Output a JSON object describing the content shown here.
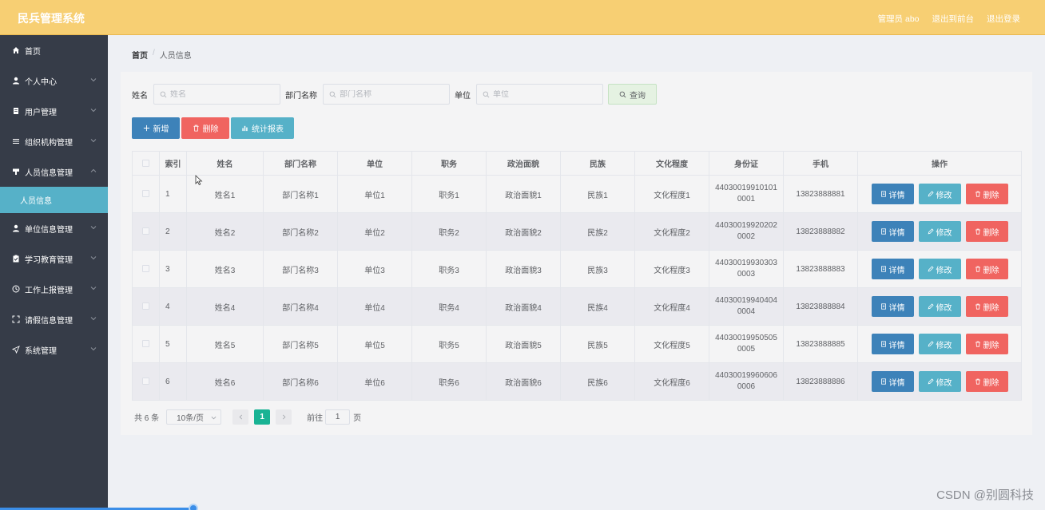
{
  "header": {
    "title": "民兵管理系统",
    "role": "管理员 abo",
    "back_link": "退出到前台",
    "logout_link": "退出登录"
  },
  "sidebar": {
    "items": [
      {
        "label": "首页",
        "icon": "home-icon",
        "expandable": false
      },
      {
        "label": "个人中心",
        "icon": "user-icon",
        "expandable": true
      },
      {
        "label": "用户管理",
        "icon": "document-icon",
        "expandable": true
      },
      {
        "label": "组织机构管理",
        "icon": "list-icon",
        "expandable": true
      },
      {
        "label": "人员信息管理",
        "icon": "podium-icon",
        "expandable": true,
        "open": true
      },
      {
        "label": "单位信息管理",
        "icon": "user-icon",
        "expandable": true
      },
      {
        "label": "学习教育管理",
        "icon": "clipboard-icon",
        "expandable": true
      },
      {
        "label": "工作上报管理",
        "icon": "clock-icon",
        "expandable": true
      },
      {
        "label": "请假信息管理",
        "icon": "fullscreen-icon",
        "expandable": true
      },
      {
        "label": "系统管理",
        "icon": "send-icon",
        "expandable": true
      }
    ],
    "active_sub": "人员信息"
  },
  "breadcrumb": {
    "home": "首页",
    "separator": "/",
    "current": "人员信息"
  },
  "search": {
    "name_label": "姓名",
    "name_placeholder": "姓名",
    "dept_label": "部门名称",
    "dept_placeholder": "部门名称",
    "unit_label": "单位",
    "unit_placeholder": "单位",
    "query_button": "查询"
  },
  "toolbar": {
    "add": "新增",
    "delete": "删除",
    "report": "统计报表"
  },
  "table": {
    "columns": [
      "索引",
      "姓名",
      "部门名称",
      "单位",
      "职务",
      "政治面貌",
      "民族",
      "文化程度",
      "身份证",
      "手机",
      "操作"
    ],
    "rows": [
      {
        "index": "1",
        "name": "姓名1",
        "dept": "部门名称1",
        "unit": "单位1",
        "duty": "职务1",
        "political": "政治面貌1",
        "ethnic": "民族1",
        "education": "文化程度1",
        "id_line1": "44030019910101",
        "id_line2": "0001",
        "phone": "13823888881"
      },
      {
        "index": "2",
        "name": "姓名2",
        "dept": "部门名称2",
        "unit": "单位2",
        "duty": "职务2",
        "political": "政治面貌2",
        "ethnic": "民族2",
        "education": "文化程度2",
        "id_line1": "44030019920202",
        "id_line2": "0002",
        "phone": "13823888882"
      },
      {
        "index": "3",
        "name": "姓名3",
        "dept": "部门名称3",
        "unit": "单位3",
        "duty": "职务3",
        "political": "政治面貌3",
        "ethnic": "民族3",
        "education": "文化程度3",
        "id_line1": "44030019930303",
        "id_line2": "0003",
        "phone": "13823888883"
      },
      {
        "index": "4",
        "name": "姓名4",
        "dept": "部门名称4",
        "unit": "单位4",
        "duty": "职务4",
        "political": "政治面貌4",
        "ethnic": "民族4",
        "education": "文化程度4",
        "id_line1": "44030019940404",
        "id_line2": "0004",
        "phone": "13823888884"
      },
      {
        "index": "5",
        "name": "姓名5",
        "dept": "部门名称5",
        "unit": "单位5",
        "duty": "职务5",
        "political": "政治面貌5",
        "ethnic": "民族5",
        "education": "文化程度5",
        "id_line1": "44030019950505",
        "id_line2": "0005",
        "phone": "13823888885"
      },
      {
        "index": "6",
        "name": "姓名6",
        "dept": "部门名称6",
        "unit": "单位6",
        "duty": "职务6",
        "political": "政治面貌6",
        "ethnic": "民族6",
        "education": "文化程度6",
        "id_line1": "44030019960606",
        "id_line2": "0006",
        "phone": "13823888886"
      }
    ],
    "actions": {
      "detail": "详情",
      "edit": "修改",
      "delete": "删除"
    }
  },
  "pagination": {
    "total": "共 6 条",
    "page_size": "10条/页",
    "current_page": "1",
    "goto_label": "前往",
    "goto_value": "1",
    "page_suffix": "页"
  },
  "watermark": "CSDN @别圆科技",
  "colors": {
    "header": "#f7cf73",
    "sidebar": "#363c48",
    "active_sub": "#56b1c8",
    "primary": "#3d82b9",
    "info": "#56b1c8",
    "danger": "#f06460",
    "page_active": "#19b394"
  }
}
